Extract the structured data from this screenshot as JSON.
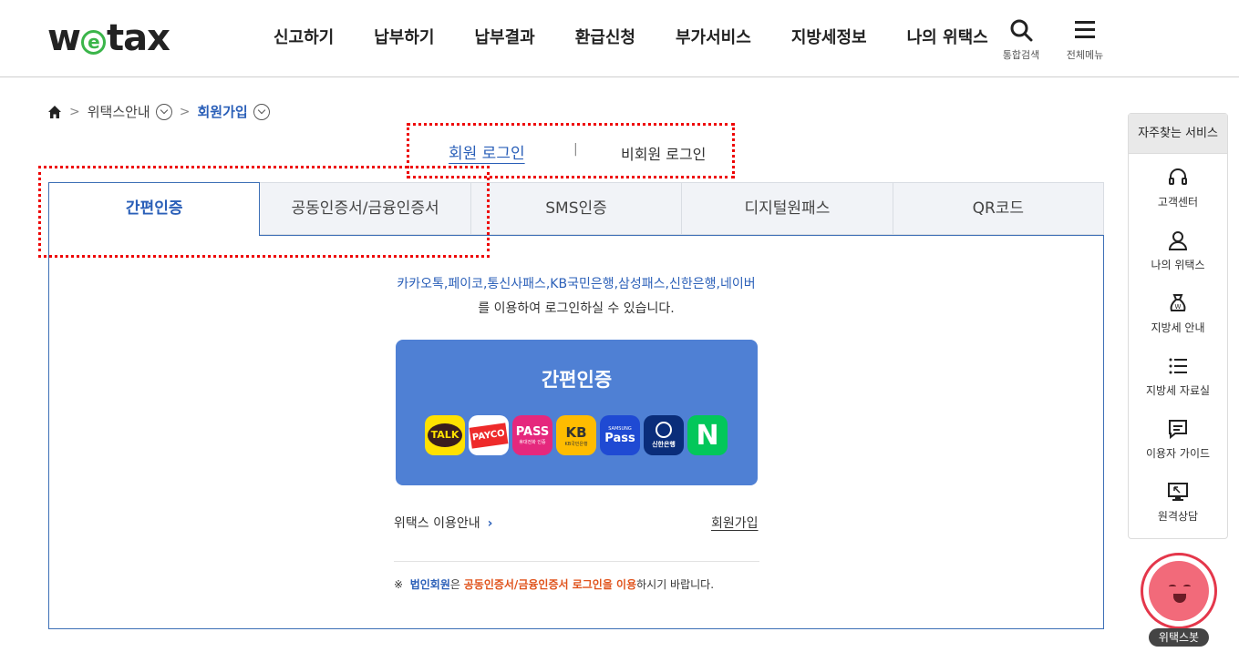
{
  "header": {
    "logo_left": "w",
    "logo_e": "e",
    "logo_right": "tax",
    "nav": [
      "신고하기",
      "납부하기",
      "납부결과",
      "환급신청",
      "부가서비스",
      "지방세정보",
      "나의 위택스"
    ],
    "search_label": "통합검색",
    "menu_label": "전체메뉴"
  },
  "breadcrumb": {
    "level1": "위택스안내",
    "current": "회원가입"
  },
  "login_toggle": {
    "member": "회원 로그인",
    "divider": "|",
    "guest": "비회원 로그인"
  },
  "tabs": [
    "간편인증",
    "공동인증서/금융인증서",
    "SMS인증",
    "디지털원패스",
    "QR코드"
  ],
  "panel": {
    "desc_providers": "카카오톡,페이코,통신사패스,KB국민은행,삼성패스,신한은행,네이버",
    "desc_suffix": "를 이용하여 로그인하실 수 있습니다.",
    "button_title": "간편인증",
    "apps": {
      "kakao": "TALK",
      "payco": "PAYCO",
      "pass": "PASS",
      "pass_sub": "휴대전화 인증",
      "kb": "KB",
      "kb_sub": "KB국민은행",
      "samsung_top": "SAMSUNG",
      "samsung": "Pass",
      "shinhan": "신한은행",
      "naver": "N"
    },
    "guide_link": "위택스 이용안내",
    "guide_arrow": "›",
    "join_link": "회원가입",
    "notice_mark": "※",
    "notice_a": "법인회원",
    "notice_b": "은 ",
    "notice_c": "공동인증서/금융인증서 로그인을 이용",
    "notice_d": "하시기 바랍니다."
  },
  "quick_menu": {
    "title": "자주찾는 서비스",
    "items": [
      "고객센터",
      "나의 위택스",
      "지방세 안내",
      "지방세 자료실",
      "이용자 가이드",
      "원격상담"
    ]
  },
  "chatbot": {
    "label": "위택스봇"
  },
  "colors": {
    "brand_green": "#3bb54a",
    "accent_blue": "#2a5fb8",
    "button_blue": "#4f80d4",
    "highlight_red": "#e00000",
    "notice_orange": "#e0531c"
  }
}
